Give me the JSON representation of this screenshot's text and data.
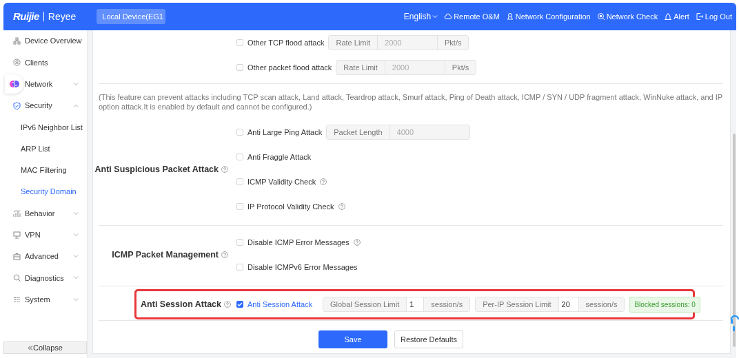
{
  "header": {
    "brand": "Ruijie",
    "product": "Reyee",
    "device_select": "Local Device(EG1",
    "language": "English",
    "links": [
      "Remote O&M",
      "Network Configuration",
      "Network Check",
      "Alert",
      "Log Out"
    ]
  },
  "sidebar": {
    "items": [
      {
        "label": "Device Overview",
        "selected": false
      },
      {
        "label": "Clients",
        "selected": false
      },
      {
        "label": "Network",
        "selected": false,
        "expanded": false
      },
      {
        "label": "Security",
        "selected": false,
        "expanded": true,
        "children": [
          {
            "label": "IPv6 Neighbor List",
            "selected": false
          },
          {
            "label": "ARP List",
            "selected": false
          },
          {
            "label": "MAC Filtering",
            "selected": false
          },
          {
            "label": "Security Domain",
            "selected": true
          }
        ]
      },
      {
        "label": "Behavior",
        "selected": false,
        "expanded": false
      },
      {
        "label": "VPN",
        "selected": false,
        "expanded": false
      },
      {
        "label": "Advanced",
        "selected": false,
        "expanded": false
      },
      {
        "label": "Diagnostics",
        "selected": false,
        "expanded": false
      },
      {
        "label": "System",
        "selected": false,
        "expanded": false
      }
    ],
    "collapse": "Collapse"
  },
  "sections": [
    {
      "rows": [
        {
          "label": "Other TCP flood attack",
          "checked": false,
          "inputs": [
            {
              "prefix": "Rate Limit",
              "value": "2000",
              "suffix": "Pkt/s",
              "disabled": true
            }
          ]
        },
        {
          "label": "Other packet flood attack",
          "checked": false,
          "inputs": [
            {
              "prefix": "Rate Limit",
              "value": "2000",
              "suffix": "Pkt/s",
              "disabled": true
            }
          ]
        }
      ]
    },
    {
      "note": "(This feature can prevent attacks including TCP scan attack, Land attack, Teardrop attack, Smurf attack, Ping of Death attack, ICMP / SYN / UDP fragment attack, WinNuke attack, and IP option attack.It is enabled by default and cannot be configured.)"
    },
    {
      "title": "Anti Suspicious Packet Attack",
      "help": true,
      "rows": [
        {
          "label": "Anti Large Ping Attack",
          "checked": false,
          "inputs": [
            {
              "prefix": "Packet Length",
              "value": "4000",
              "disabled": true
            }
          ]
        },
        {
          "label": "Anti Fraggle Attack",
          "checked": false
        },
        {
          "label": "ICMP Validity Check",
          "checked": false,
          "help": true
        },
        {
          "label": "IP Protocol Validity Check",
          "checked": false,
          "help": true
        }
      ]
    },
    {
      "title": "ICMP Packet Management",
      "help": true,
      "rows": [
        {
          "label": "Disable ICMP Error Messages",
          "checked": false,
          "help": true
        },
        {
          "label": "Disable ICMPv6 Error Messages",
          "checked": false
        }
      ]
    },
    {
      "title": "Anti Session Attack",
      "help": true,
      "highlighted": true,
      "rows": [
        {
          "label": "Anti Session Attack",
          "checked": true,
          "inputs": [
            {
              "prefix": "Global Session Limit",
              "value": "1",
              "suffix": "session/s",
              "disabled": false
            },
            {
              "prefix": "Per-IP Session Limit",
              "value": "20",
              "suffix": "session/s",
              "disabled": false
            }
          ],
          "badge": "Blocked sessions: 0"
        }
      ]
    }
  ],
  "buttons": [
    {
      "label": "Save",
      "primary": true
    },
    {
      "label": "Restore Defaults",
      "primary": false
    }
  ]
}
